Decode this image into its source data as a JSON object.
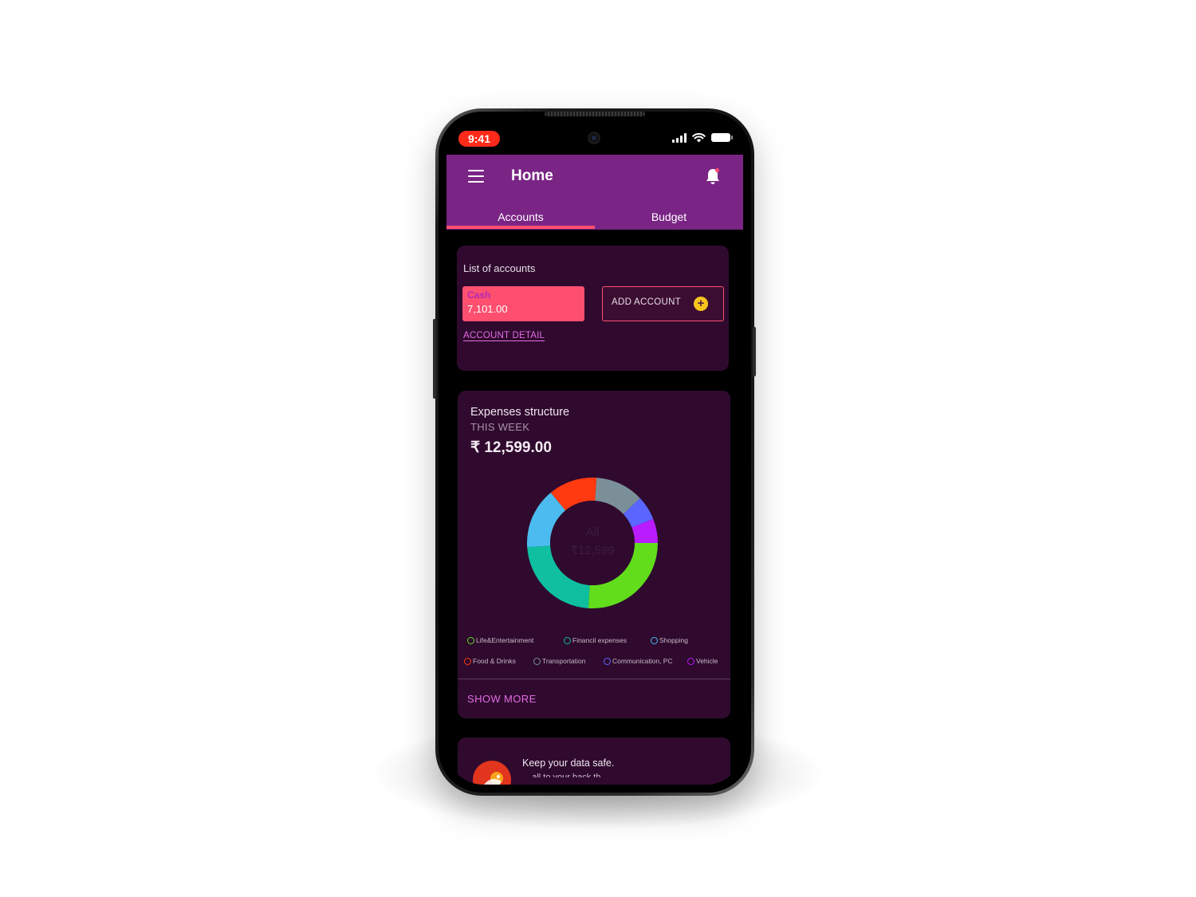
{
  "status_bar": {
    "time": "9:41"
  },
  "header": {
    "title": "Home",
    "tabs": [
      {
        "label": "Accounts",
        "active": true
      },
      {
        "label": "Budget",
        "active": false
      }
    ]
  },
  "accounts_card": {
    "title": "List of accounts",
    "account": {
      "name": "Cash",
      "balance": "7,101.00"
    },
    "add_account_label": "ADD ACCOUNT",
    "detail_link": "ACCOUNT DETAIL"
  },
  "expenses_card": {
    "title": "Expenses structure",
    "period": "THIS WEEK",
    "total": "₹ 12,599.00",
    "center_label": "All",
    "center_value": "₹12,599",
    "show_more": "SHOW MORE",
    "legend": [
      {
        "label": "Life&Entertainment",
        "color": "#61dd1c"
      },
      {
        "label": "Financil expenses",
        "color": "#0fbfa0"
      },
      {
        "label": "Shopping",
        "color": "#4cbcf0"
      },
      {
        "label": "Food & Drinks",
        "color": "#ff3a10"
      },
      {
        "label": "Transportation",
        "color": "#7b8f98"
      },
      {
        "label": "Communication, PC",
        "color": "#5a66ff"
      },
      {
        "label": "Vehicle",
        "color": "#b81cff"
      }
    ]
  },
  "chart_data": {
    "type": "pie",
    "title": "Expenses structure",
    "categories": [
      "Life&Entertainment",
      "Financil expenses",
      "Shopping",
      "Food & Drinks",
      "Transportation",
      "Communication, PC",
      "Vehicle"
    ],
    "values": [
      26,
      23,
      15,
      12,
      12,
      6,
      6
    ],
    "colors": [
      "#61dd1c",
      "#0fbfa0",
      "#4cbcf0",
      "#ff3a10",
      "#7b8f98",
      "#5a66ff",
      "#b81cff"
    ],
    "donut": true,
    "unit": "percent"
  },
  "safe_card": {
    "title": "Keep your data safe.",
    "subtitle": "... all to your back th..."
  },
  "colors": {
    "header_bg": "#7a2585",
    "card_bg": "#2f0a2e",
    "accent_pink": "#ff4f6f",
    "link": "#e46be4",
    "plus_yellow": "#f7c41c"
  }
}
